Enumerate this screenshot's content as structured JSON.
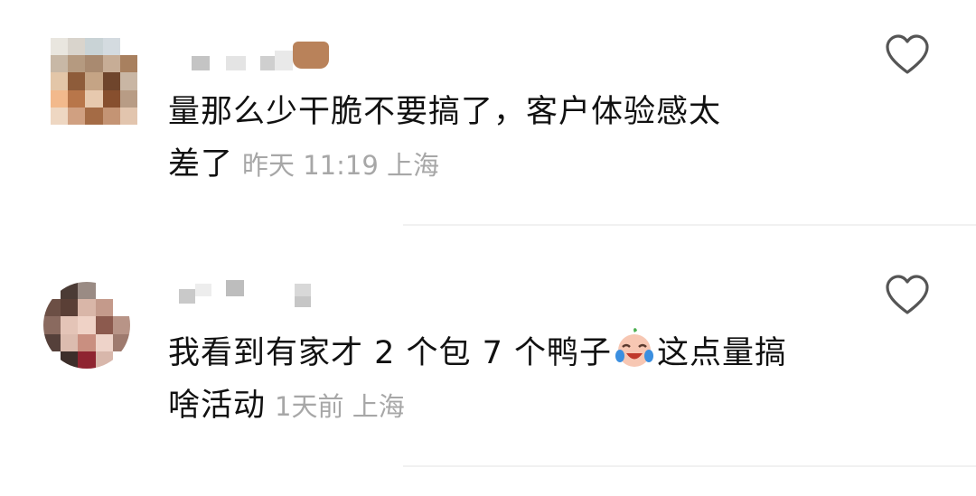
{
  "comments": [
    {
      "text": "量那么少干脆不要搞了，客户体验感太\n差了",
      "time": "昨天 11:19",
      "location": "上海"
    },
    {
      "text_before": "我看到有家才 2 个包 7 个鸭子",
      "emoji": "crying-laughing-face-emoji",
      "text_after": "这点量搞\n啥活动",
      "time": "1天前",
      "location": "上海"
    }
  ],
  "icons": {
    "like": "heart-outline-icon"
  },
  "colors": {
    "text": "#111111",
    "meta": "#a7a7a7",
    "divider": "#f1f1f1",
    "heart_stroke": "#555555"
  }
}
